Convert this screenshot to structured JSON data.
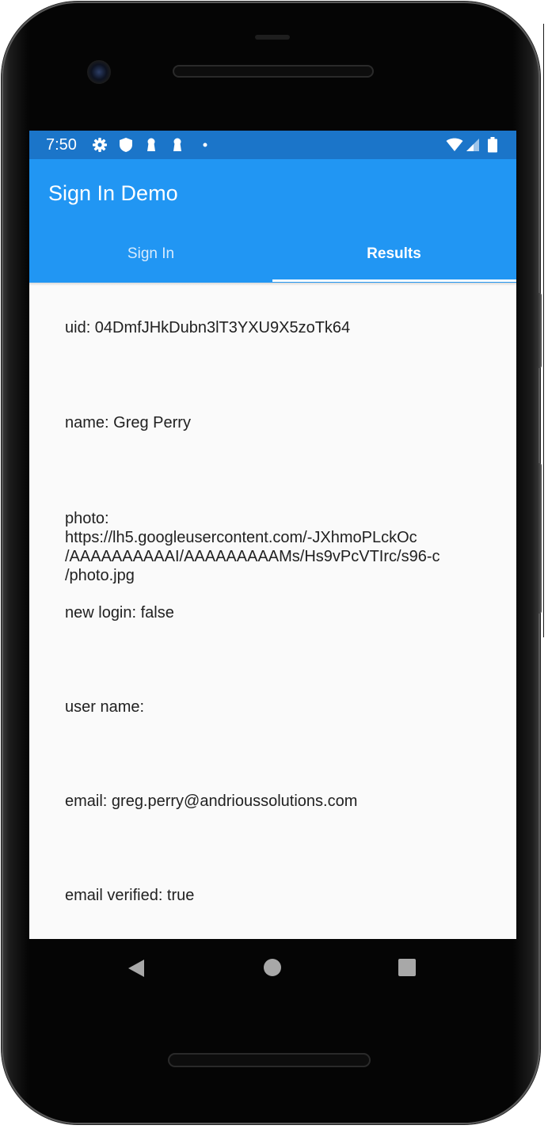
{
  "status_bar": {
    "time": "7:50",
    "left_icons": [
      "gear-icon",
      "shield-icon",
      "keyhole-icon",
      "keyhole-icon",
      "dot-icon"
    ],
    "right_icons": [
      "wifi-icon",
      "signal-icon",
      "battery-icon"
    ]
  },
  "app_bar": {
    "title": "Sign In Demo",
    "color": "#2196f3"
  },
  "tabs": [
    {
      "label": "Sign In",
      "selected": false
    },
    {
      "label": "Results",
      "selected": true
    }
  ],
  "results": {
    "uid": "uid: 04DmfJHkDubn3lT3YXU9X5zoTk64",
    "name": "name: Greg Perry",
    "photo_lines": [
      "photo:",
      "https://lh5.googleusercontent.com/-JXhmoPLckOc",
      "/AAAAAAAAAAI/AAAAAAAAAMs/Hs9vPcVTIrc/s96-c",
      "/photo.jpg"
    ],
    "new_login": "new login: false",
    "user_name": "user name:",
    "email": "email: greg.perry@andrioussolutions.com",
    "email_verified": "email verified: true"
  },
  "nav_bar": {
    "buttons": [
      "back-icon",
      "home-icon",
      "recents-icon"
    ]
  }
}
